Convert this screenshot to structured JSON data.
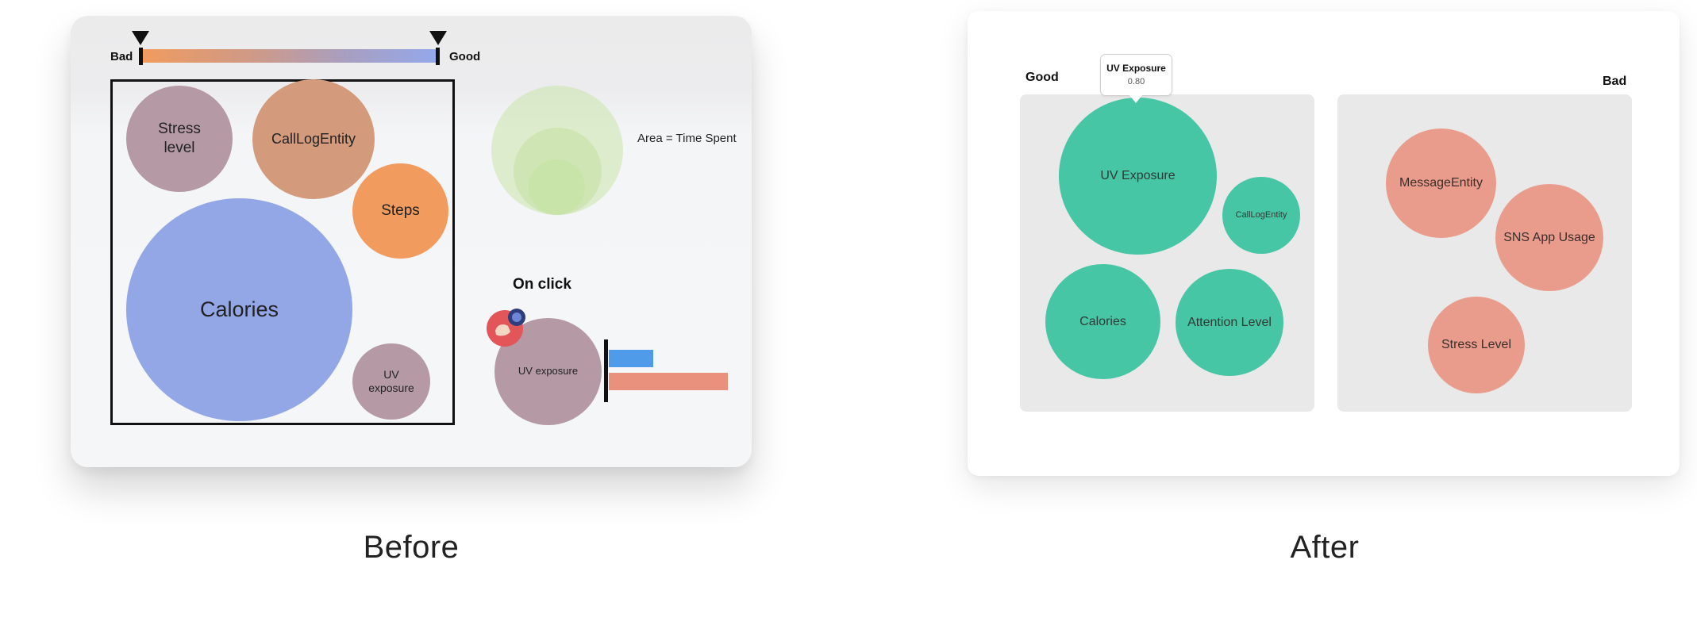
{
  "before": {
    "scale": {
      "bad_label": "Bad",
      "good_label": "Good"
    },
    "bubbles": [
      {
        "label": "Stress\nlevel",
        "color": "#b59aa5"
      },
      {
        "label": "CallLogEntity",
        "color": "#d39a7c"
      },
      {
        "label": "Steps",
        "color": "#f19b5e"
      },
      {
        "label": "Calories",
        "color": "#93a7e6"
      },
      {
        "label": "UV\nexposure",
        "color": "#b59aa5"
      }
    ],
    "legend": {
      "note": "Area = Time Spent",
      "color": "#c6e3a4"
    },
    "on_click": {
      "title": "On click",
      "bubble_label": "UV exposure",
      "bubble_color": "#b59aa5",
      "bars": [
        {
          "value": 0.37,
          "color": "#4f9be9"
        },
        {
          "value": 1.0,
          "color": "#e9917d"
        }
      ]
    },
    "caption": "Before"
  },
  "after": {
    "good": {
      "label": "Good",
      "bubbles": [
        {
          "label": "UV Exposure"
        },
        {
          "label": "CallLogEntity"
        },
        {
          "label": "Calories"
        },
        {
          "label": "Attention Level"
        }
      ],
      "color": "#46c6a4"
    },
    "bad": {
      "label": "Bad",
      "bubbles": [
        {
          "label": "MessageEntity"
        },
        {
          "label": "SNS App Usage"
        },
        {
          "label": "Stress Level"
        }
      ],
      "color": "#ea9c8c"
    },
    "tooltip": {
      "title": "UV Exposure",
      "value": "0.80"
    },
    "caption": "After"
  }
}
